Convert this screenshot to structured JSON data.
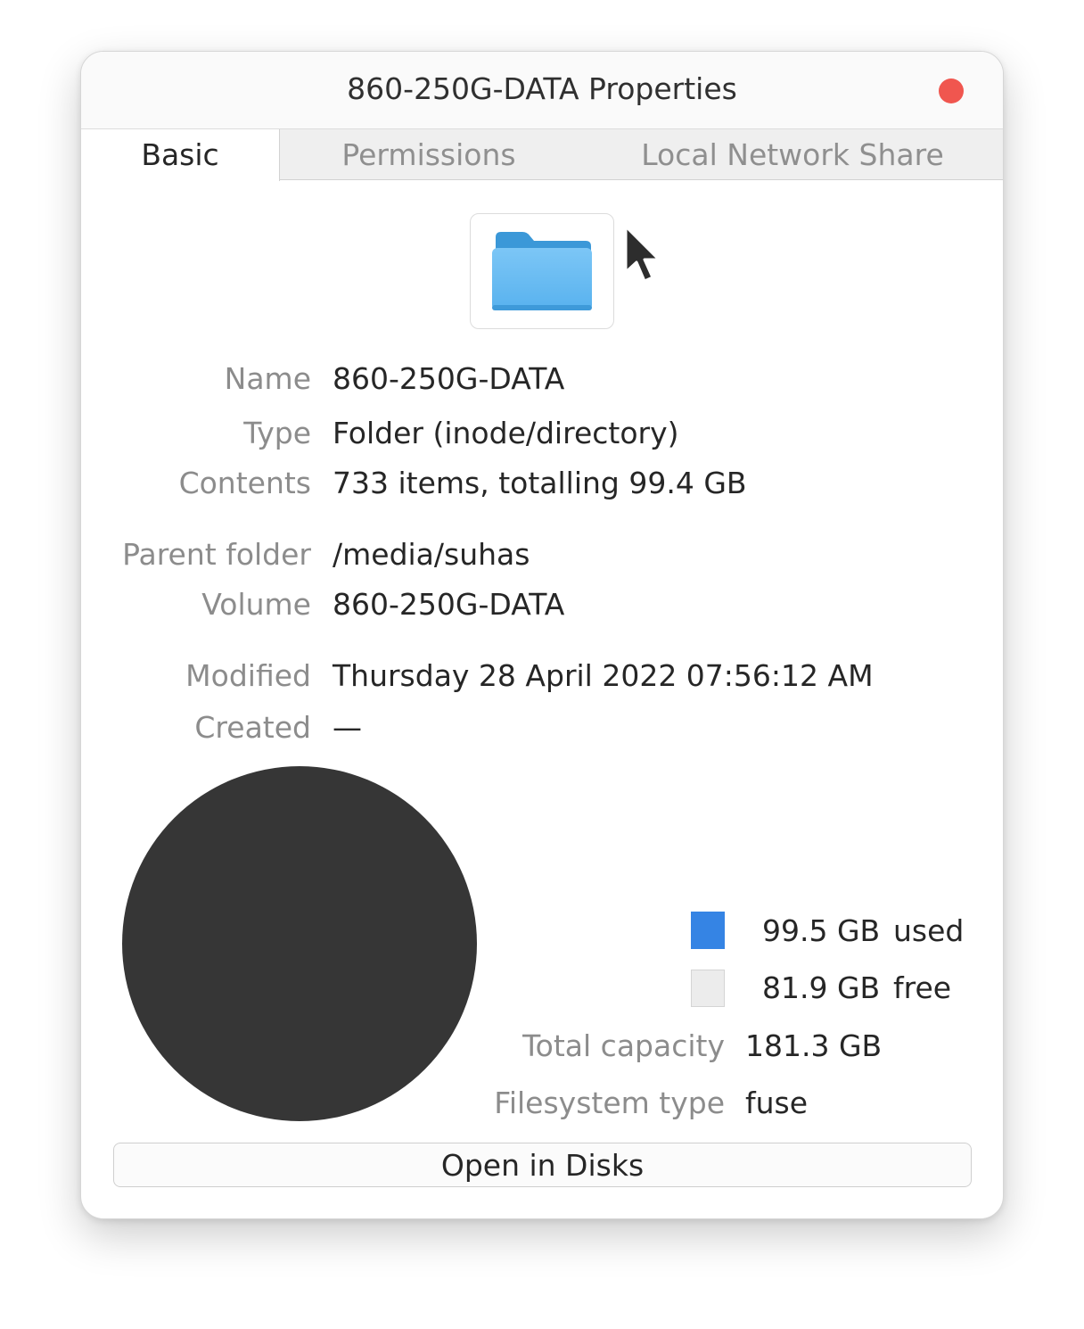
{
  "window": {
    "title": "860-250G-DATA Properties"
  },
  "tabs": [
    {
      "label": "Basic",
      "active": true
    },
    {
      "label": "Permissions",
      "active": false
    },
    {
      "label": "Local Network Share",
      "active": false
    }
  ],
  "icon": {
    "name": "folder-icon"
  },
  "properties": {
    "name": {
      "label": "Name",
      "value": "860-250G-DATA"
    },
    "type": {
      "label": "Type",
      "value": "Folder (inode/directory)"
    },
    "contents": {
      "label": "Contents",
      "value": "733 items, totalling 99.4 GB"
    },
    "parent": {
      "label": "Parent folder",
      "value": "/media/suhas"
    },
    "volume": {
      "label": "Volume",
      "value": "860-250G-DATA"
    },
    "modified": {
      "label": "Modified",
      "value": "Thursday 28 April 2022 07:56:12 AM"
    },
    "created": {
      "label": "Created",
      "value": "—"
    }
  },
  "usage": {
    "used": {
      "amount": "99.5 GB",
      "label": "used",
      "color": "#3584e4"
    },
    "free": {
      "amount": "81.9 GB",
      "label": "free",
      "color": "#ececec"
    },
    "total": {
      "label": "Total capacity",
      "value": "181.3 GB"
    },
    "filesystem": {
      "label": "Filesystem type",
      "value": "fuse"
    },
    "pie_color": "#363636"
  },
  "open_in_disks": "Open in Disks"
}
